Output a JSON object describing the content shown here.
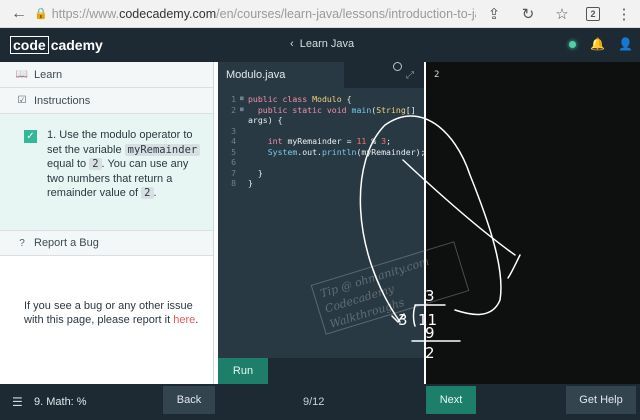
{
  "browser": {
    "url_prefix": "https://www.",
    "url_domain": "codecademy.com",
    "url_path": "/en/courses/learn-java/lessons/introduction-to-java/...",
    "tab_count": "2"
  },
  "header": {
    "logo_code": "code",
    "logo_academy": "cademy",
    "course_title": "Learn Java"
  },
  "left_panel": {
    "learn_label": "Learn",
    "instructions_label": "Instructions",
    "instruction": {
      "number": "1.",
      "text_1": "Use the modulo operator to set the variable",
      "var_name": "myRemainder",
      "text_2": "equal to",
      "value_1": "2",
      "text_3": ". You can use any two numbers that return a remainder value of",
      "value_2": "2",
      "text_4": "."
    },
    "report_label": "Report a Bug",
    "report_text": "If you see a bug or any other issue with this page, please report it",
    "report_link": "here",
    "report_end": "."
  },
  "editor": {
    "file_name": "Modulo.java",
    "line_numbers": [
      "1",
      "2",
      "3",
      "4",
      "5",
      "6",
      "7",
      "8"
    ],
    "run_label": "Run"
  },
  "output": {
    "text": "2"
  },
  "drawing": {
    "watermark_line1": "Tip @ ohmanity.com",
    "watermark_line2": "Codecademy Walkthroughs",
    "digit_quotient": "3",
    "digit_divisor": "3",
    "digit_dividend": "11",
    "digit_product": "9",
    "digit_remainder": "2"
  },
  "bottom_bar": {
    "lesson_name": "9. Math: %",
    "back_label": "Back",
    "page_indicator": "9/12",
    "next_label": "Next",
    "help_label": "Get Help"
  },
  "colors": {
    "header_bg": "#1d2a33",
    "editor_bg": "#293944",
    "accent_green": "#1d7f6a",
    "check_green": "#34b89a",
    "instruction_bg": "#e7f6f3",
    "link_red": "#e85b5b"
  }
}
